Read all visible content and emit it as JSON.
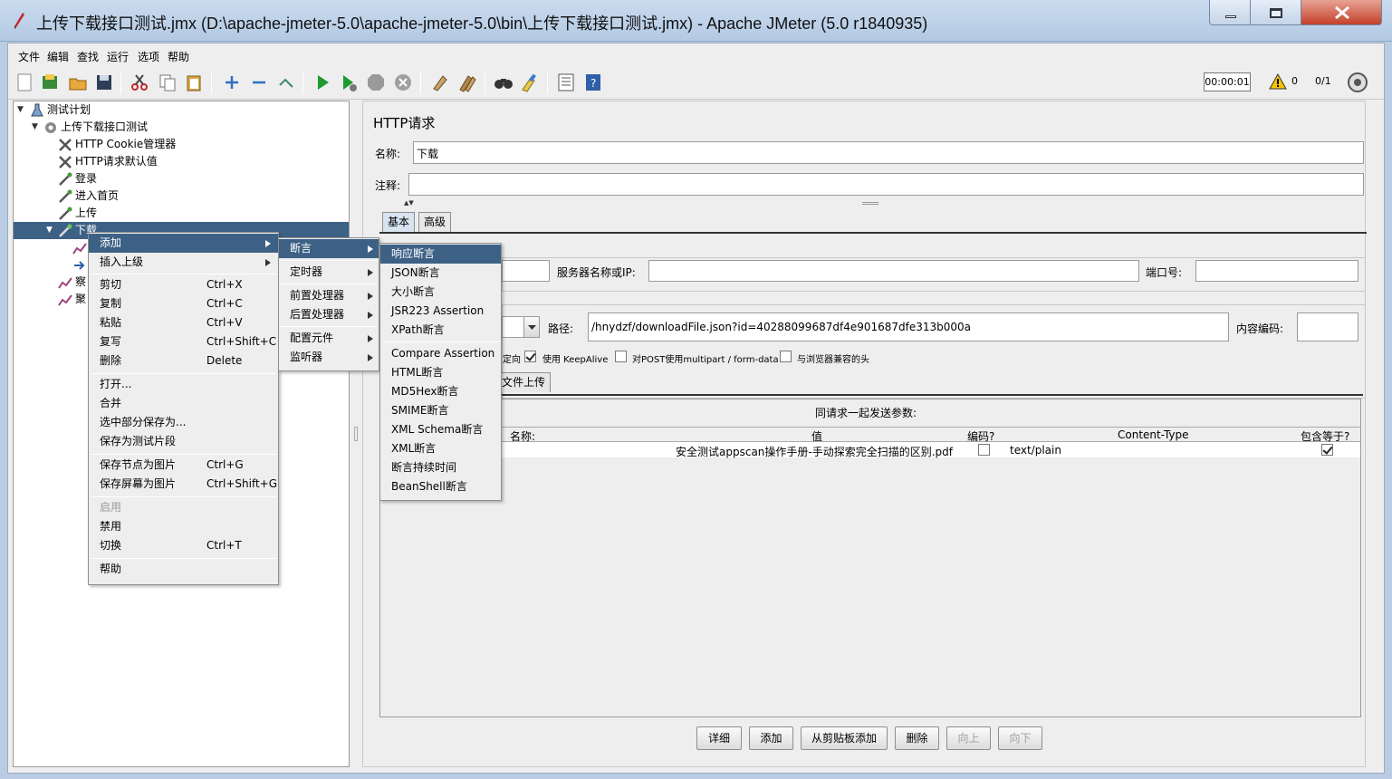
{
  "window": {
    "title": "上传下载接口测试.jmx (D:\\apache-jmeter-5.0\\apache-jmeter-5.0\\bin\\上传下载接口测试.jmx) - Apache JMeter (5.0 r1840935)"
  },
  "menubar": [
    "文件",
    "编辑",
    "查找",
    "运行",
    "选项",
    "帮助"
  ],
  "toolbar": {
    "timer": "00:00:01",
    "warnings": "0",
    "threads": "0/1"
  },
  "tree": {
    "root": "测试计划",
    "group": "上传下载接口测试",
    "items": [
      "HTTP Cookie管理器",
      "HTTP请求默认值",
      "登录",
      "进入首页",
      "上传",
      "下载"
    ],
    "partial": [
      "察",
      "聚"
    ]
  },
  "panel": {
    "title": "HTTP请求",
    "name_label": "名称:",
    "name_value": "下载",
    "comment_label": "注释:",
    "tabs": [
      "基本",
      "高级"
    ],
    "server_label": "服务器名称或IP:",
    "port_label": "端口号:",
    "path_label": "路径:",
    "path_value": "/hnydzf/downloadFile.json?id=40288099687df4e901687dfe313b000a",
    "encoding_label": "内容编码:",
    "redirect_partial": "定向",
    "keepalive": "使用 KeepAlive",
    "multipart": "对POST使用multipart / form-data",
    "browser_headers": "与浏览器兼容的头",
    "files_tab": "文件上传",
    "params_title": "同请求一起发送参数:",
    "columns": [
      "名称:",
      "值",
      "编码?",
      "Content-Type",
      "包含等于?"
    ],
    "row": {
      "value": "安全测试appscan操作手册-手动探索完全扫描的区别.pdf",
      "content_type": "text/plain"
    },
    "buttons": [
      "详细",
      "添加",
      "从剪贴板添加",
      "删除",
      "向上",
      "向下"
    ]
  },
  "context_menu": [
    {
      "label": "添加",
      "key": ""
    },
    {
      "label": "插入上级",
      "key": ""
    },
    {
      "label": "剪切",
      "key": "Ctrl+X"
    },
    {
      "label": "复制",
      "key": "Ctrl+C"
    },
    {
      "label": "粘贴",
      "key": "Ctrl+V"
    },
    {
      "label": "复写",
      "key": "Ctrl+Shift+C"
    },
    {
      "label": "删除",
      "key": "Delete"
    },
    {
      "label": "打开...",
      "key": ""
    },
    {
      "label": "合并",
      "key": ""
    },
    {
      "label": "选中部分保存为...",
      "key": ""
    },
    {
      "label": "保存为测试片段",
      "key": ""
    },
    {
      "label": "保存节点为图片",
      "key": "Ctrl+G"
    },
    {
      "label": "保存屏幕为图片",
      "key": "Ctrl+Shift+G"
    },
    {
      "label": "启用",
      "key": ""
    },
    {
      "label": "禁用",
      "key": ""
    },
    {
      "label": "切换",
      "key": "Ctrl+T"
    },
    {
      "label": "帮助",
      "key": ""
    }
  ],
  "submenu_add": [
    "断言",
    "定时器",
    "前置处理器",
    "后置处理器",
    "配置元件",
    "监听器"
  ],
  "submenu_assert": [
    "响应断言",
    "JSON断言",
    "大小断言",
    "JSR223 Assertion",
    "XPath断言",
    "Compare Assertion",
    "HTML断言",
    "MD5Hex断言",
    "SMIME断言",
    "XML Schema断言",
    "XML断言",
    "断言持续时间",
    "BeanShell断言"
  ]
}
